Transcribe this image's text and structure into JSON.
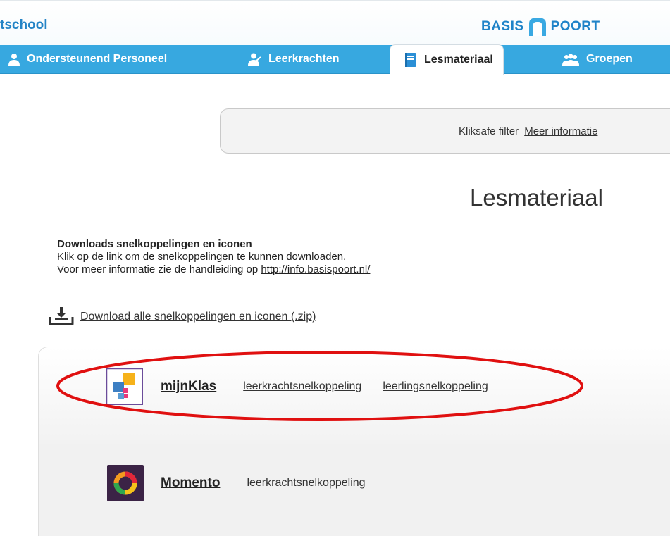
{
  "header": {
    "school_name": "tschool",
    "logo": {
      "left": "BASIS",
      "right": "POORT",
      "color": "#1f83c8"
    }
  },
  "tabs": [
    {
      "label": "Ondersteunend Personeel",
      "icon": "user-icon"
    },
    {
      "label": "Leerkrachten",
      "icon": "teacher-icon"
    },
    {
      "label": "Lesmateriaal",
      "icon": "book-icon",
      "active": true
    },
    {
      "label": "Groepen",
      "icon": "group-icon"
    }
  ],
  "filter": {
    "label": "Kliksafe filter",
    "link": "Meer informatie"
  },
  "page": {
    "title": "Lesmateriaal"
  },
  "intro": {
    "heading": "Downloads snelkoppelingen en iconen",
    "line1": "Klik op de link om de snelkoppelingen te kunnen downloaden.",
    "line2_prefix": "Voor meer informatie zie de handleiding op ",
    "line2_link": "http://info.basispoort.nl/"
  },
  "download_all": {
    "label": "Download alle snelkoppelingen en iconen (.zip)",
    "icon": "download-icon"
  },
  "apps": [
    {
      "name": "mijnKlas",
      "links": [
        "leerkrachtsnelkoppeling",
        "leerlingsnelkoppeling"
      ],
      "icon": "mijnklas-icon"
    },
    {
      "name": "Momento",
      "links": [
        "leerkrachtsnelkoppeling"
      ],
      "icon": "momento-icon"
    }
  ],
  "colors": {
    "tabbar": "#37a8e0",
    "annotation": "#e01010"
  }
}
